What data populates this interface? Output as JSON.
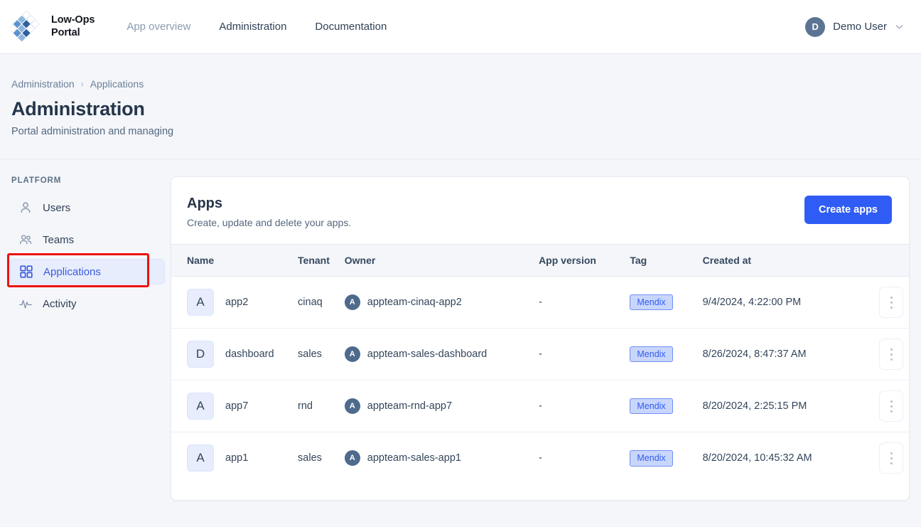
{
  "header": {
    "brand_name": "Low-Ops\nPortal",
    "logo_icon": "diamond-grid-logo",
    "nav": [
      {
        "label": "App overview",
        "muted": true
      },
      {
        "label": "Administration",
        "muted": false
      },
      {
        "label": "Documentation",
        "muted": false
      }
    ],
    "user": {
      "initial": "D",
      "name": "Demo User",
      "chevron_icon": "chevron-down-icon"
    }
  },
  "page": {
    "breadcrumb": [
      "Administration",
      "Applications"
    ],
    "breadcrumb_separator": "›",
    "title": "Administration",
    "subtitle": "Portal administration and managing"
  },
  "sidebar": {
    "section_label": "PLATFORM",
    "items": [
      {
        "label": "Users",
        "icon": "user-icon",
        "active": false
      },
      {
        "label": "Teams",
        "icon": "users-group-icon",
        "active": false
      },
      {
        "label": "Applications",
        "icon": "grid-squares-icon",
        "active": true
      },
      {
        "label": "Activity",
        "icon": "activity-pulse-icon",
        "active": false
      }
    ],
    "highlight": {
      "target": "Applications",
      "color": "#ee1111"
    }
  },
  "card": {
    "title": "Apps",
    "subtitle": "Create, update and delete your apps.",
    "create_button": "Create apps",
    "create_button_color": "#2f5cf5"
  },
  "table": {
    "columns": [
      "Name",
      "Tenant",
      "Owner",
      "App version",
      "Tag",
      "Created at"
    ],
    "row_action_icon": "kebab-menu-icon",
    "rows": [
      {
        "badge": "A",
        "name": "app2",
        "tenant": "cinaq",
        "owner_initial": "A",
        "owner": "appteam-cinaq-app2",
        "app_version": "-",
        "tag": "Mendix",
        "created_at": "9/4/2024, 4:22:00 PM"
      },
      {
        "badge": "D",
        "name": "dashboard",
        "tenant": "sales",
        "owner_initial": "A",
        "owner": "appteam-sales-dashboard",
        "app_version": "-",
        "tag": "Mendix",
        "created_at": "8/26/2024, 8:47:37 AM"
      },
      {
        "badge": "A",
        "name": "app7",
        "tenant": "rnd",
        "owner_initial": "A",
        "owner": "appteam-rnd-app7",
        "app_version": "-",
        "tag": "Mendix",
        "created_at": "8/20/2024, 2:25:15 PM"
      },
      {
        "badge": "A",
        "name": "app1",
        "tenant": "sales",
        "owner_initial": "A",
        "owner": "appteam-sales-app1",
        "app_version": "-",
        "tag": "Mendix",
        "created_at": "8/20/2024, 10:45:32 AM"
      }
    ]
  }
}
